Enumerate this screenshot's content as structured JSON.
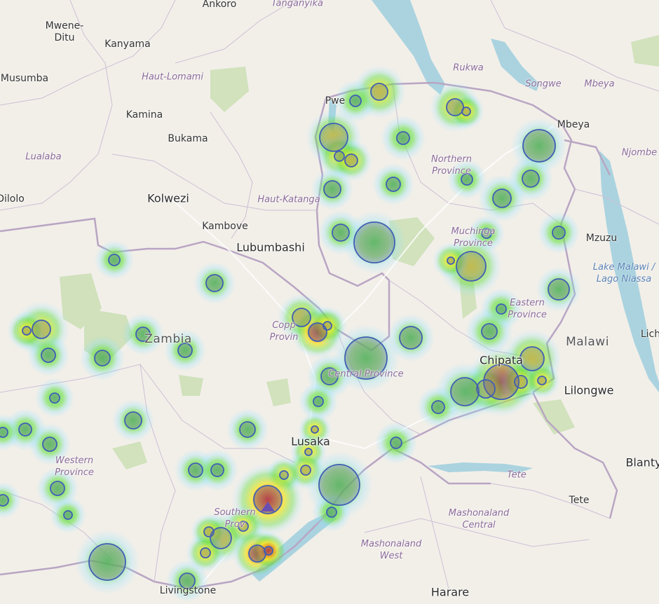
{
  "labels": {
    "mwene_ditu": "Mwene-\nDitu",
    "kanyama": "Kanyama",
    "ankoro": "Ankoro",
    "tanganyika": "Tanganyika",
    "musumba": "Musumba",
    "haut_lomami": "Haut-Lomami",
    "kamina": "Kamina",
    "bukama": "Bukama",
    "lualaba": "Lualaba",
    "dilolo": "Dilolo",
    "kolwezi": "Kolwezi",
    "haut_katanga": "Haut-Katanga",
    "kambove": "Kambove",
    "lubumbashi": "Lubumbashi",
    "pweto": "Pwe",
    "rukwa": "Rukwa",
    "songwe": "Songwe",
    "mbeya_region": "Mbeya",
    "mbeya_city": "Mbeya",
    "njombe": "Njombe",
    "northern_province": "Northern\nProvince",
    "muchinga": "Muchinga\nProvince",
    "mzuzu": "Mzuzu",
    "lake_malawi": "Lake Malawi /\nLago Niassa",
    "eastern_province": "Eastern\nProvince",
    "copperbelt": "Copp\nProvin",
    "zambia": "Zambia",
    "malawi": "Malawi",
    "lichinga": "Lich",
    "chipata": "Chipata",
    "lilongwe": "Lilongwe",
    "central_province": "Central Province",
    "lusaka": "Lusaka",
    "western_province": "Western\nProvince",
    "southern_province": "Southern\nProv",
    "tete_region": "Tete",
    "tete_city": "Tete",
    "blantyre": "Blanty",
    "mashonaland_central": "Mashonaland\nCentral",
    "mashonaland_west": "Mashonaland\nWest",
    "harare": "Harare",
    "livingstone": "Livingstone"
  },
  "heat_points": [
    {
      "name": "nw-cluster-1",
      "value": 0.6
    },
    {
      "name": "nw-cluster-2",
      "value": 0.4
    }
  ],
  "legend": {}
}
